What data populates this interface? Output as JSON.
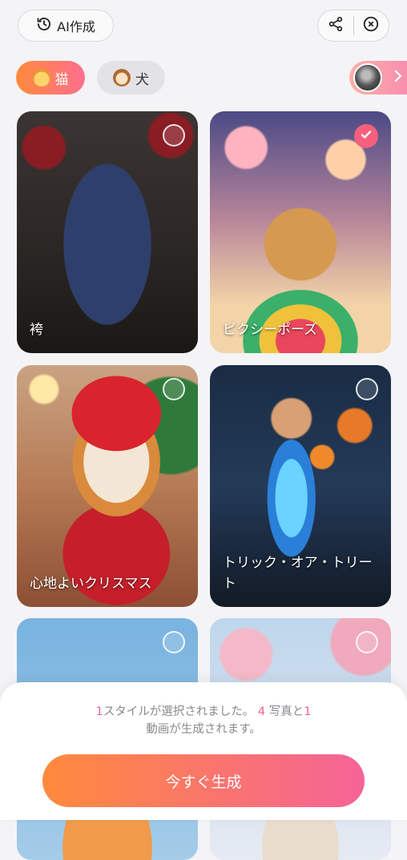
{
  "header": {
    "history_label": "AI作成",
    "share_icon": "share-icon",
    "close_icon": "close-circle-icon"
  },
  "tabs": [
    {
      "label": "猫",
      "icon": "cat-face-icon",
      "active": true
    },
    {
      "label": "犬",
      "icon": "dog-face-icon",
      "active": false
    }
  ],
  "styles": [
    {
      "label": "袴",
      "selected": false
    },
    {
      "label": "ピクシーポーズ",
      "selected": true
    },
    {
      "label": "心地よいクリスマス",
      "selected": false
    },
    {
      "label": "トリック・オア・トリート",
      "selected": false
    },
    {
      "label": "",
      "selected": false
    },
    {
      "label": "",
      "selected": false
    }
  ],
  "summary": {
    "style_count": "1",
    "style_text": "スタイルが選択されました。",
    "photo_count": "4",
    "photo_text": " 写真と",
    "video_count": "1",
    "video_text": "動画が生成されます。"
  },
  "generate_label": "今すぐ生成",
  "colors": {
    "accent_start": "#ff8a3c",
    "accent_end": "#f56398",
    "highlight": "#f2608d"
  }
}
